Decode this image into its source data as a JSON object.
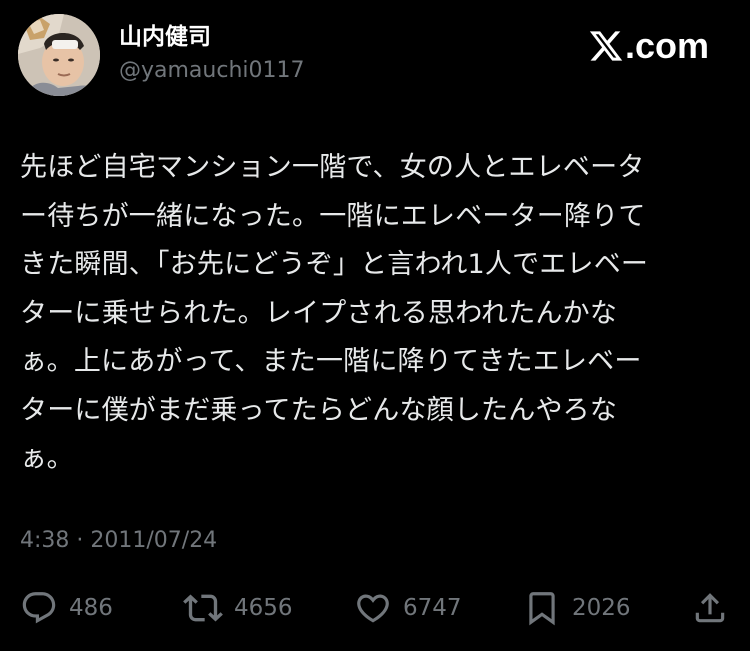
{
  "author": {
    "display_name": "山内健司",
    "handle": "@yamauchi0117"
  },
  "brand": {
    "text": ".com",
    "icon": "x-logo-icon"
  },
  "tweet": {
    "lines": [
      "先ほど自宅マンション一階で、女の人とエレベータ",
      "ー待ちが一緒になった。一階にエレベーター降りて",
      "きた瞬間、「お先にどうぞ」と言われ1人でエレベー",
      "ターに乗せられた。レイプされる思われたんかな",
      "ぁ。上にあがって、また一階に降りてきたエレベー",
      "ターに僕がまだ乗ってたらどんな顔したんやろな",
      "ぁ。"
    ],
    "timestamp": "4:38 · 2011/07/24"
  },
  "actions": {
    "reply": {
      "icon": "reply-icon",
      "count": "486"
    },
    "repost": {
      "icon": "repost-icon",
      "count": "4656"
    },
    "like": {
      "icon": "heart-icon",
      "count": "6747"
    },
    "bookmark": {
      "icon": "bookmark-icon",
      "count": "2026"
    },
    "share": {
      "icon": "share-icon"
    }
  },
  "colors": {
    "background": "#000000",
    "text": "#e7e9ea",
    "muted": "#71767b"
  }
}
